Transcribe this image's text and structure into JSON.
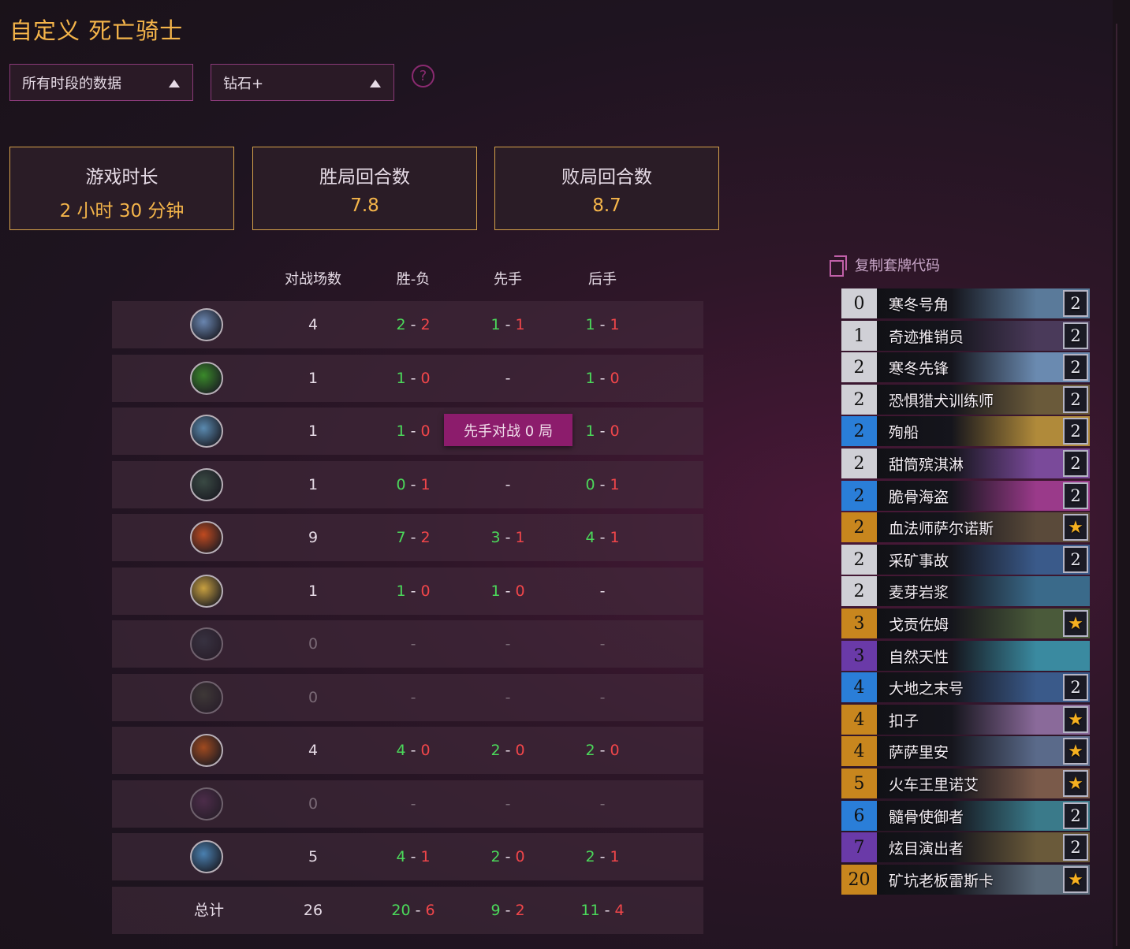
{
  "page": {
    "title": "自定义 死亡骑士"
  },
  "filters": {
    "time_range": "所有时段的数据",
    "rank": "钻石+",
    "help": "?"
  },
  "stats": [
    {
      "label": "游戏时长",
      "value": "2 小时 30 分钟"
    },
    {
      "label": "胜局回合数",
      "value": "7.8"
    },
    {
      "label": "败局回合数",
      "value": "8.7"
    }
  ],
  "table": {
    "headers": {
      "games": "对战场数",
      "wl": "胜-负",
      "first": "先手",
      "second": "后手"
    },
    "rows": [
      {
        "icon": "shield-sword-icon",
        "color": "#6a86b0",
        "games": "4",
        "wl": [
          "2",
          "2"
        ],
        "first": [
          "1",
          "1"
        ],
        "second": [
          "1",
          "1"
        ]
      },
      {
        "icon": "green-fel-icon",
        "color": "#3a8a2a",
        "games": "1",
        "wl": [
          "1",
          "0"
        ],
        "first": null,
        "second": [
          "1",
          "0"
        ]
      },
      {
        "icon": "bear-paw-icon",
        "color": "#5a8ab0",
        "games": "1",
        "wl": [
          "1",
          "0"
        ],
        "first": null,
        "second": [
          "1",
          "0"
        ]
      },
      {
        "icon": "bow-icon",
        "color": "#3a4a44",
        "games": "1",
        "wl": [
          "0",
          "1"
        ],
        "first": null,
        "second": [
          "0",
          "1"
        ]
      },
      {
        "icon": "fire-icon",
        "color": "#c04a20",
        "games": "9",
        "wl": [
          "7",
          "2"
        ],
        "first": [
          "3",
          "1"
        ],
        "second": [
          "4",
          "1"
        ]
      },
      {
        "icon": "holy-tome-icon",
        "color": "#c8a040",
        "games": "1",
        "wl": [
          "1",
          "0"
        ],
        "first": [
          "1",
          "0"
        ],
        "second": null
      },
      {
        "icon": "dagger-icon",
        "color": "#3a4654",
        "games": "0",
        "wl": null,
        "first": null,
        "second": null
      },
      {
        "icon": "totem-icon",
        "color": "#4a5440",
        "games": "0",
        "wl": null,
        "first": null,
        "second": null
      },
      {
        "icon": "demon-icon",
        "color": "#a04a20",
        "games": "4",
        "wl": [
          "4",
          "0"
        ],
        "first": [
          "2",
          "0"
        ],
        "second": [
          "2",
          "0"
        ]
      },
      {
        "icon": "shadow-hand-icon",
        "color": "#6a3a6a",
        "games": "0",
        "wl": null,
        "first": null,
        "second": null
      },
      {
        "icon": "sword-icon",
        "color": "#4a80b0",
        "games": "5",
        "wl": [
          "4",
          "1"
        ],
        "first": [
          "2",
          "0"
        ],
        "second": [
          "2",
          "1"
        ]
      }
    ],
    "total": {
      "label": "总计",
      "games": "26",
      "wl": [
        "20",
        "6"
      ],
      "first": [
        "9",
        "2"
      ],
      "second": [
        "11",
        "4"
      ]
    },
    "dash": "-"
  },
  "tooltip": "先手对战 0 局",
  "deck": {
    "copy_label": "复制套牌代码",
    "cards": [
      {
        "cost": "0",
        "name": "寒冬号角",
        "count": "2",
        "rarity": "common",
        "art": "#5a7a9a"
      },
      {
        "cost": "1",
        "name": "奇迹推销员",
        "count": "2",
        "rarity": "common",
        "art": "#4a3a5a"
      },
      {
        "cost": "2",
        "name": "寒冬先锋",
        "count": "2",
        "rarity": "common",
        "art": "#6a8ab0"
      },
      {
        "cost": "2",
        "name": "恐惧猎犬训练师",
        "count": "2",
        "rarity": "common",
        "art": "#6a5a3a"
      },
      {
        "cost": "2",
        "name": "殉船",
        "count": "2",
        "rarity": "rare",
        "art": "#b08a3a"
      },
      {
        "cost": "2",
        "name": "甜筒殡淇淋",
        "count": "2",
        "rarity": "common",
        "art": "#7a4a9a"
      },
      {
        "cost": "2",
        "name": "脆骨海盗",
        "count": "2",
        "rarity": "rare",
        "art": "#9a3a8a"
      },
      {
        "cost": "2",
        "name": "血法师萨尔诺斯",
        "count": "★",
        "rarity": "legendary",
        "art": "#5a4a3a"
      },
      {
        "cost": "2",
        "name": "采矿事故",
        "count": "2",
        "rarity": "common",
        "art": "#3a5a8a"
      },
      {
        "cost": "2",
        "name": "麦芽岩浆",
        "count": "",
        "rarity": "common",
        "art": "#3a6a8a"
      },
      {
        "cost": "3",
        "name": "戈贡佐姆",
        "count": "★",
        "rarity": "legendary",
        "art": "#4a5a3a"
      },
      {
        "cost": "3",
        "name": "自然天性",
        "count": "",
        "rarity": "epic",
        "art": "#3a8aa0"
      },
      {
        "cost": "4",
        "name": "大地之末号",
        "count": "2",
        "rarity": "rare",
        "art": "#3a5a8a"
      },
      {
        "cost": "4",
        "name": "扣子",
        "count": "★",
        "rarity": "legendary",
        "art": "#8a6a9a"
      },
      {
        "cost": "4",
        "name": "萨萨里安",
        "count": "★",
        "rarity": "legendary",
        "art": "#5a6a8a"
      },
      {
        "cost": "5",
        "name": "火车王里诺艾",
        "count": "★",
        "rarity": "legendary",
        "art": "#7a5a4a"
      },
      {
        "cost": "6",
        "name": "髓骨使御者",
        "count": "2",
        "rarity": "rare",
        "art": "#3a7a8a"
      },
      {
        "cost": "7",
        "name": "炫目演出者",
        "count": "2",
        "rarity": "epic",
        "art": "#6a5a3a"
      },
      {
        "cost": "20",
        "name": "矿坑老板雷斯卡",
        "count": "★",
        "rarity": "legendary",
        "art": "#5a6a7a"
      }
    ]
  }
}
